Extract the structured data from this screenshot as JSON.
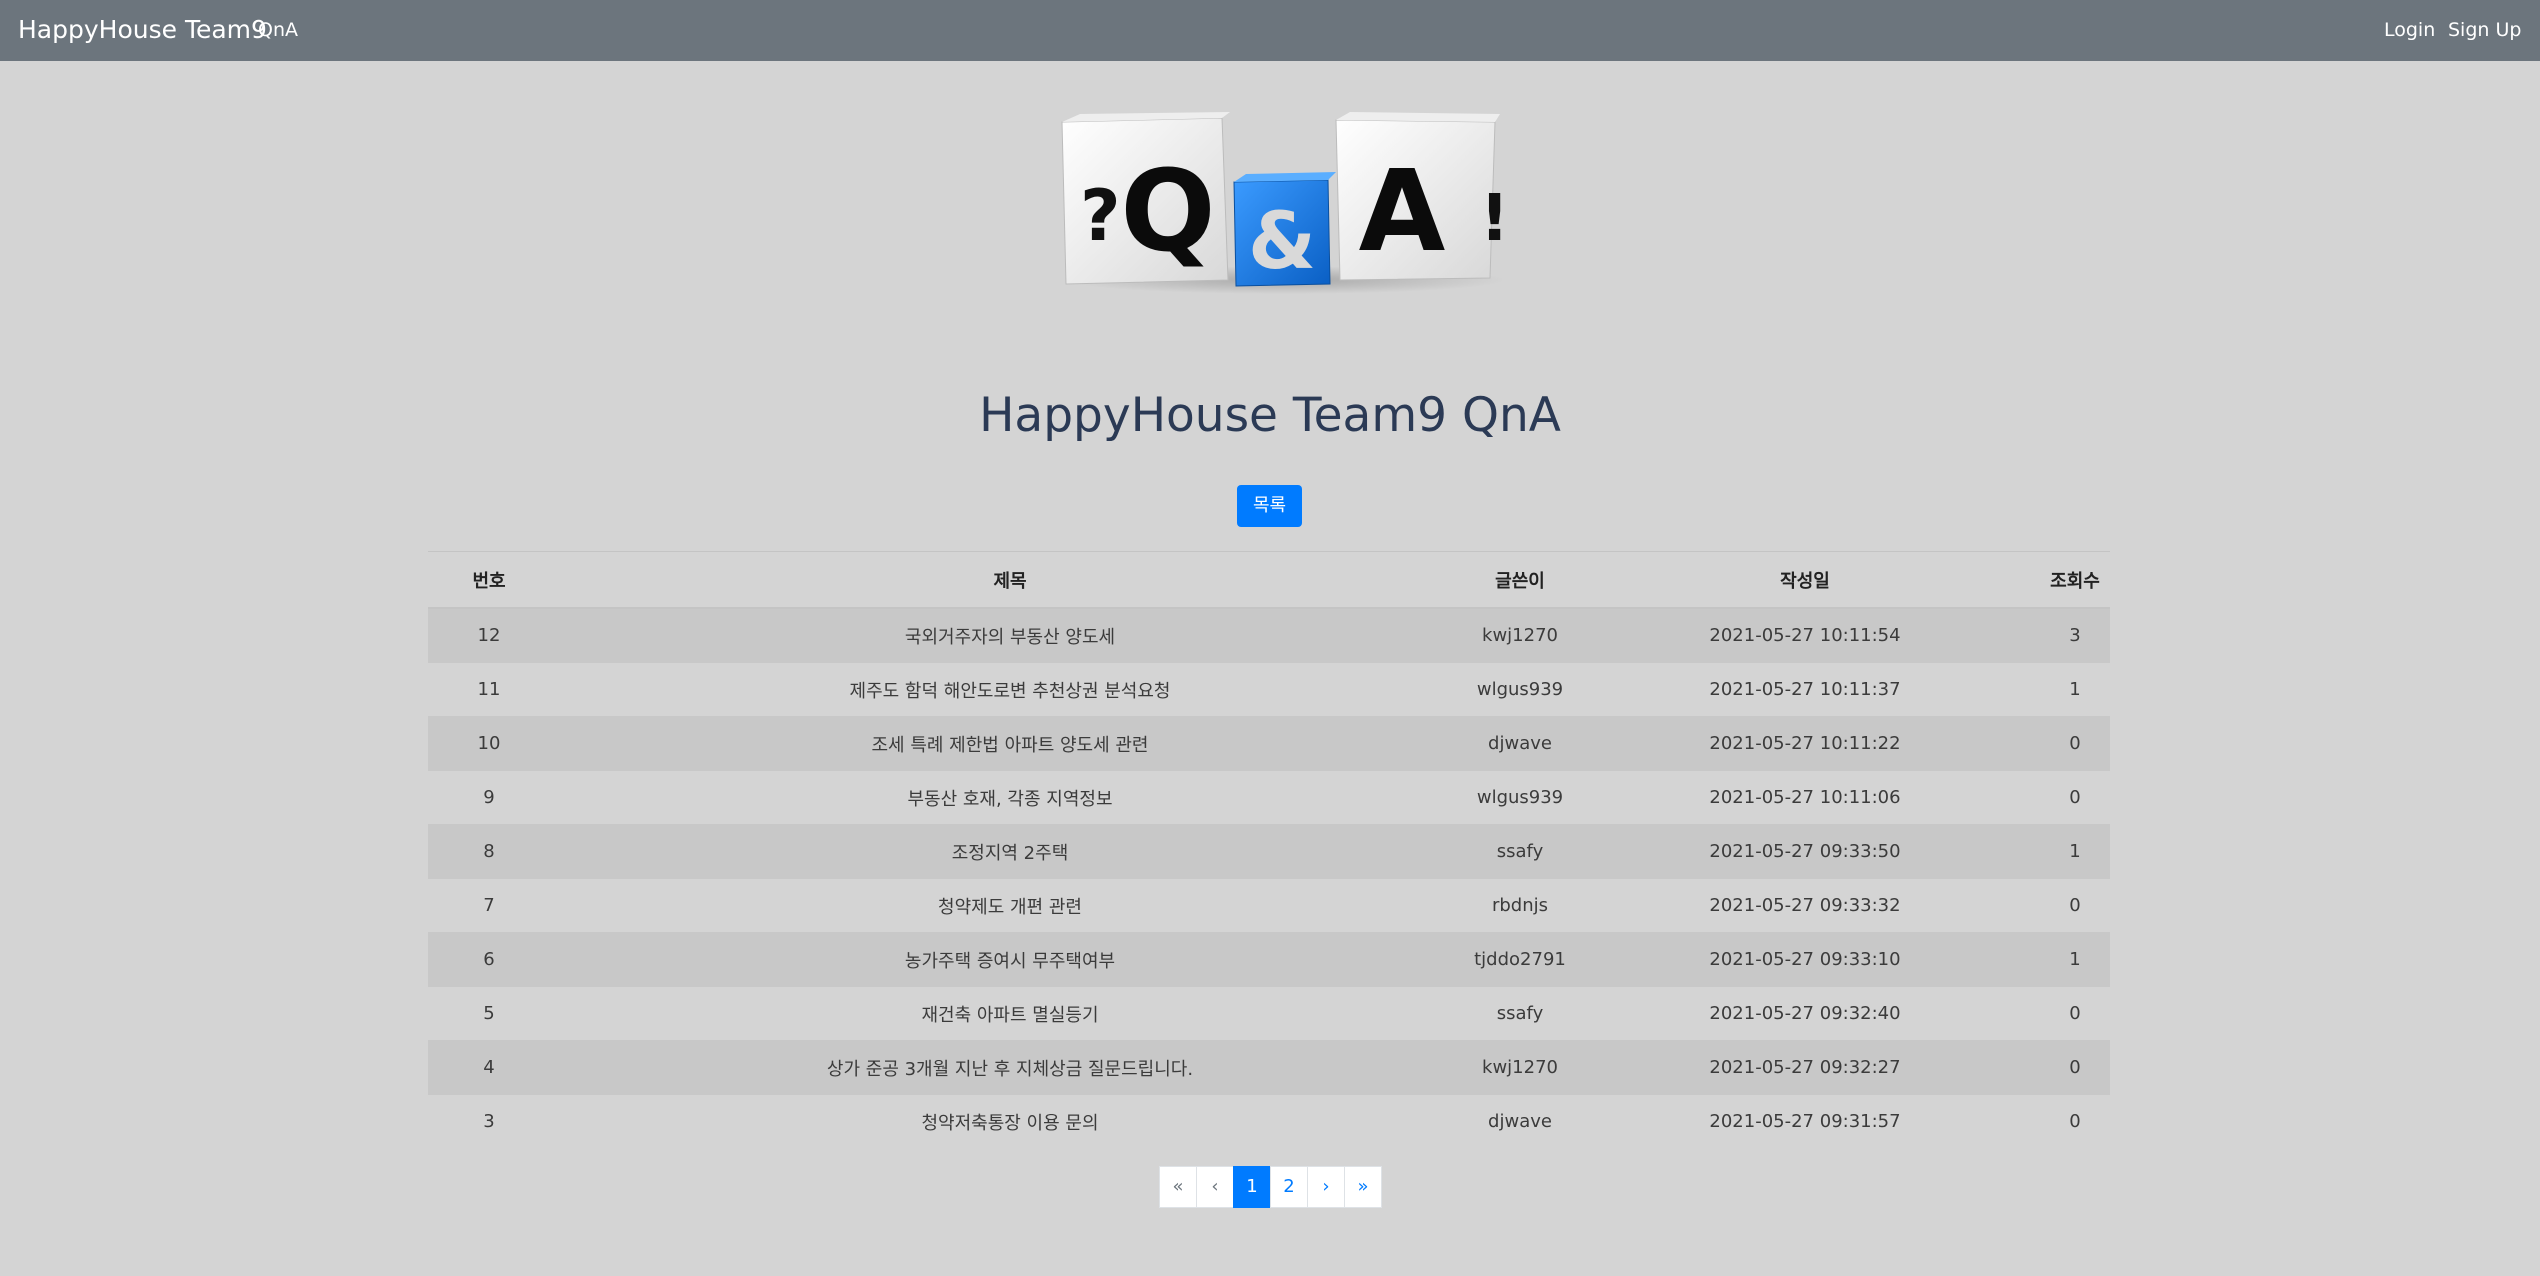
{
  "navbar": {
    "brand": "HappyHouse Team9",
    "links": [
      "QnA"
    ],
    "right_links": [
      "Login",
      "Sign Up"
    ]
  },
  "hero": {
    "letters": [
      "?",
      "Q",
      "&",
      "A",
      "!"
    ],
    "colors": {
      "dice_white": "#f2f2f2",
      "dice_blue": "#1a73d9"
    }
  },
  "page": {
    "title": "HappyHouse Team9 QnA",
    "list_button": "목록"
  },
  "table": {
    "headers": [
      "번호",
      "제목",
      "글쓴이",
      "작성일",
      "조회수"
    ],
    "rows": [
      {
        "no": "12",
        "title": "국외거주자의 부동산 양도세",
        "writer": "kwj1270",
        "date": "2021-05-27 10:11:54",
        "views": "3"
      },
      {
        "no": "11",
        "title": "제주도 함덕 해안도로변 추천상권 분석요청",
        "writer": "wlgus939",
        "date": "2021-05-27 10:11:37",
        "views": "1"
      },
      {
        "no": "10",
        "title": "조세 특례 제한법 아파트 양도세 관련",
        "writer": "djwave",
        "date": "2021-05-27 10:11:22",
        "views": "0"
      },
      {
        "no": "9",
        "title": "부동산 호재, 각종 지역정보",
        "writer": "wlgus939",
        "date": "2021-05-27 10:11:06",
        "views": "0"
      },
      {
        "no": "8",
        "title": "조정지역 2주택",
        "writer": "ssafy",
        "date": "2021-05-27 09:33:50",
        "views": "1"
      },
      {
        "no": "7",
        "title": "청약제도 개편 관련",
        "writer": "rbdnjs",
        "date": "2021-05-27 09:33:32",
        "views": "0"
      },
      {
        "no": "6",
        "title": "농가주택 증여시 무주택여부",
        "writer": "tjddo2791",
        "date": "2021-05-27 09:33:10",
        "views": "1"
      },
      {
        "no": "5",
        "title": "재건축 아파트 멸실등기",
        "writer": "ssafy",
        "date": "2021-05-27 09:32:40",
        "views": "0"
      },
      {
        "no": "4",
        "title": "상가 준공 3개월 지난 후 지체상금 질문드립니다.",
        "writer": "kwj1270",
        "date": "2021-05-27 09:32:27",
        "views": "0"
      },
      {
        "no": "3",
        "title": "청약저축통장 이용 문의",
        "writer": "djwave",
        "date": "2021-05-27 09:31:57",
        "views": "0"
      }
    ]
  },
  "pagination": {
    "first": "«",
    "prev": "‹",
    "pages": [
      "1",
      "2"
    ],
    "current": "1",
    "next": "›",
    "last": "»"
  }
}
